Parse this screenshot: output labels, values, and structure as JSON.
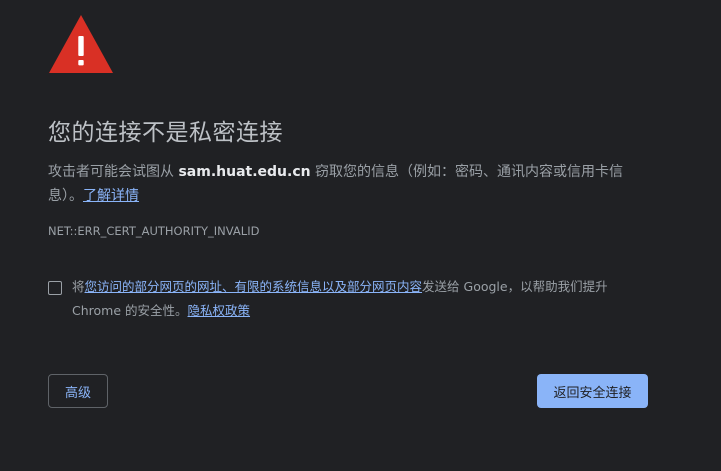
{
  "icon": {
    "name": "warning-icon",
    "color": "#d93025"
  },
  "heading": "您的连接不是私密连接",
  "description": {
    "before": "攻击者可能会试图从 ",
    "host": "sam.huat.edu.cn",
    "after": " 窃取您的信息（例如：密码、通讯内容或信用卡信息）。",
    "learn_more": "了解详情"
  },
  "error_code": "NET::ERR_CERT_AUTHORITY_INVALID",
  "consent": {
    "prefix": "将",
    "link": "您访问的部分网页的网址、有限的系统信息以及部分网页内容",
    "middle": "发送给 Google，以帮助我们提升 Chrome 的安全性。",
    "privacy_link": "隐私权政策"
  },
  "buttons": {
    "advanced": "高级",
    "back_to_safety": "返回安全连接"
  },
  "colors": {
    "background": "#202124",
    "link": "#8ab4f8",
    "primary_button": "#8ab4f8",
    "warning": "#d93025"
  }
}
